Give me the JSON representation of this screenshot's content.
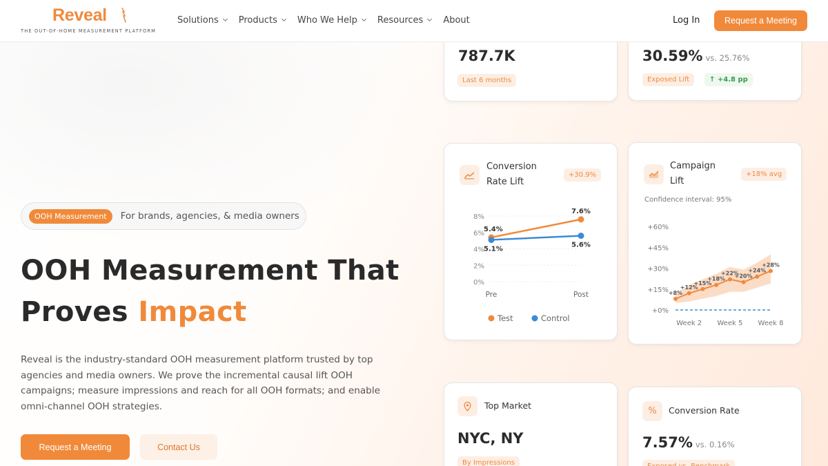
{
  "brand": {
    "name": "Reveal",
    "tagline": "THE OUT-OF-HOME MEASUREMENT PLATFORM"
  },
  "nav": {
    "items": [
      {
        "label": "Solutions",
        "dropdown": true
      },
      {
        "label": "Products",
        "dropdown": true
      },
      {
        "label": "Who We Help",
        "dropdown": true
      },
      {
        "label": "Resources",
        "dropdown": true
      },
      {
        "label": "About",
        "dropdown": false
      }
    ],
    "login": "Log In",
    "cta": "Request a Meeting"
  },
  "hero": {
    "pill_tag": "OOH Measurement",
    "pill_text": "For brands, agencies, & media owners",
    "headline_line1": "OOH Measurement That",
    "headline_line2_plain": "Proves ",
    "headline_line2_accent": "Impact",
    "description": "Reveal is the industry-standard OOH measurement platform trusted by top agencies and media owners. We prove the incremental causal lift OOH campaigns; measure impressions and reach for all OOH formats; and enable omni-channel OOH strategies.",
    "primary_button": "Request a Meeting",
    "secondary_button": "Contact Us"
  },
  "cards": {
    "reach": {
      "value": "787.7K",
      "chip": "Last 6 months"
    },
    "exposed": {
      "value": "30.59%",
      "vs": "vs. 25.76%",
      "chip": "Exposed Lift",
      "delta": "+4.8 pp"
    },
    "conversion_lift": {
      "title_line1": "Conversion",
      "title_line2": "Rate Lift",
      "badge": "+30.9%"
    },
    "campaign_lift": {
      "title_line1": "Campaign",
      "title_line2": "Lift",
      "badge": "+18% avg",
      "subtitle": "Confidence interval: 95%"
    },
    "top_market": {
      "title": "Top Market",
      "value": "NYC, NY",
      "chip": "By Impressions"
    },
    "conversion_rate": {
      "title": "Conversion Rate",
      "value": "7.57%",
      "vs": "vs. 0.16%",
      "chip": "Exposed vs. Benchmark"
    }
  },
  "colors": {
    "accent": "#f08a3a",
    "control": "#3b8ad9",
    "green": "#3b9a4a"
  },
  "chart_data": [
    {
      "type": "line",
      "title": "Conversion Rate Lift",
      "categories": [
        "Pre",
        "Post"
      ],
      "y_ticks": [
        "0%",
        "2%",
        "4%",
        "6%",
        "8%"
      ],
      "ylim": [
        0,
        8
      ],
      "legend_position": "bottom",
      "series": [
        {
          "name": "Test",
          "values": [
            5.4,
            7.6
          ],
          "labels": [
            "5.4%",
            "7.6%"
          ],
          "color": "#f08a3a"
        },
        {
          "name": "Control",
          "values": [
            5.1,
            5.6
          ],
          "labels": [
            "5.1%",
            "5.6%"
          ],
          "color": "#3b8ad9"
        }
      ]
    },
    {
      "type": "line",
      "title": "Campaign Lift",
      "x_ticks": [
        "Week 2",
        "Week 5",
        "Week 8"
      ],
      "x": [
        1,
        2,
        3,
        4,
        5,
        6,
        7,
        8
      ],
      "y_ticks": [
        "+0%",
        "+15%",
        "+30%",
        "+45%",
        "+60%"
      ],
      "ylim": [
        0,
        60
      ],
      "series": [
        {
          "values": [
            8,
            12,
            15,
            18,
            22,
            20,
            24,
            28
          ],
          "labels": [
            "+8%",
            "+12%",
            "+15%",
            "+18%",
            "+22%",
            "+20%",
            "+24%",
            "+28%"
          ],
          "color": "#f08a3a"
        }
      ],
      "confidence_band": {
        "lower": [
          5,
          6,
          8,
          10,
          13,
          13,
          16,
          19
        ],
        "upper": [
          11,
          18,
          22,
          26,
          31,
          29,
          34,
          40
        ]
      },
      "baseline": 0
    }
  ]
}
